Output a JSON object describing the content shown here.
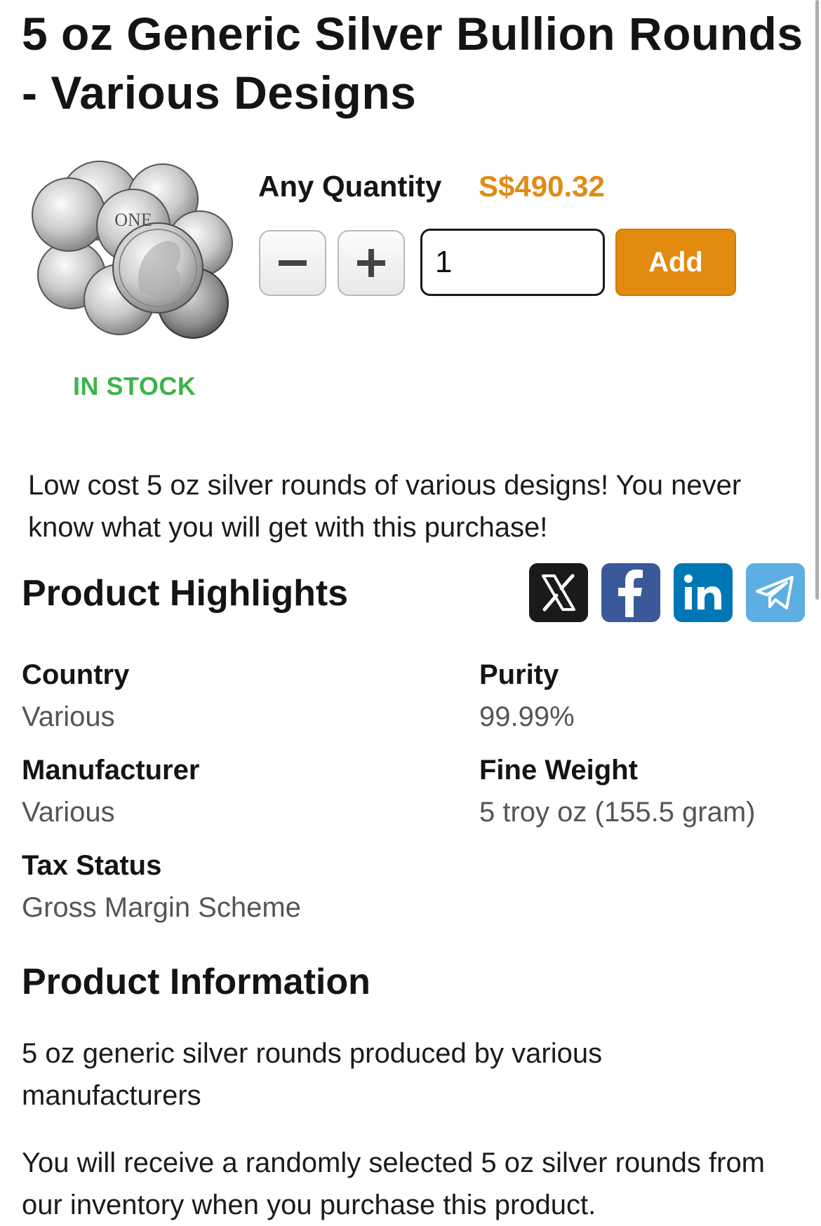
{
  "product": {
    "title": "5 oz Generic Silver Bullion Rounds - Various Designs",
    "image_alt": "silver rounds image",
    "stock_status": "IN STOCK",
    "quantity_label": "Any Quantity",
    "price": "S$490.32",
    "quantity_value": "1",
    "add_label": "Add",
    "minus_symbol": "−",
    "plus_symbol": "+",
    "coin_text": "ONE",
    "intro": "Low cost 5 oz silver rounds of various designs! You never know what you will get with this purchase!"
  },
  "highlights": {
    "heading": "Product Highlights",
    "share_icons": [
      "x-icon",
      "facebook-icon",
      "linkedin-icon",
      "telegram-icon"
    ],
    "specs": {
      "country": {
        "label": "Country",
        "value": "Various"
      },
      "purity": {
        "label": "Purity",
        "value": "99.99%"
      },
      "manufacturer": {
        "label": "Manufacturer",
        "value": "Various"
      },
      "fine_weight": {
        "label": "Fine Weight",
        "value": "5 troy oz (155.5 gram)"
      },
      "tax_status": {
        "label": "Tax Status",
        "value": "Gross Margin Scheme"
      }
    }
  },
  "information": {
    "heading": "Product Information",
    "paragraphs": [
      "5 oz generic silver rounds produced by various manufacturers",
      "You will receive a randomly selected 5 oz silver rounds from our inventory when you purchase this product."
    ]
  },
  "colors": {
    "accent": "#e38a10",
    "price": "#e08b16",
    "in_stock": "#3bb54a",
    "facebook": "#3b5998",
    "linkedin": "#0077b5",
    "telegram": "#5caee3",
    "x": "#1a1a1a"
  }
}
